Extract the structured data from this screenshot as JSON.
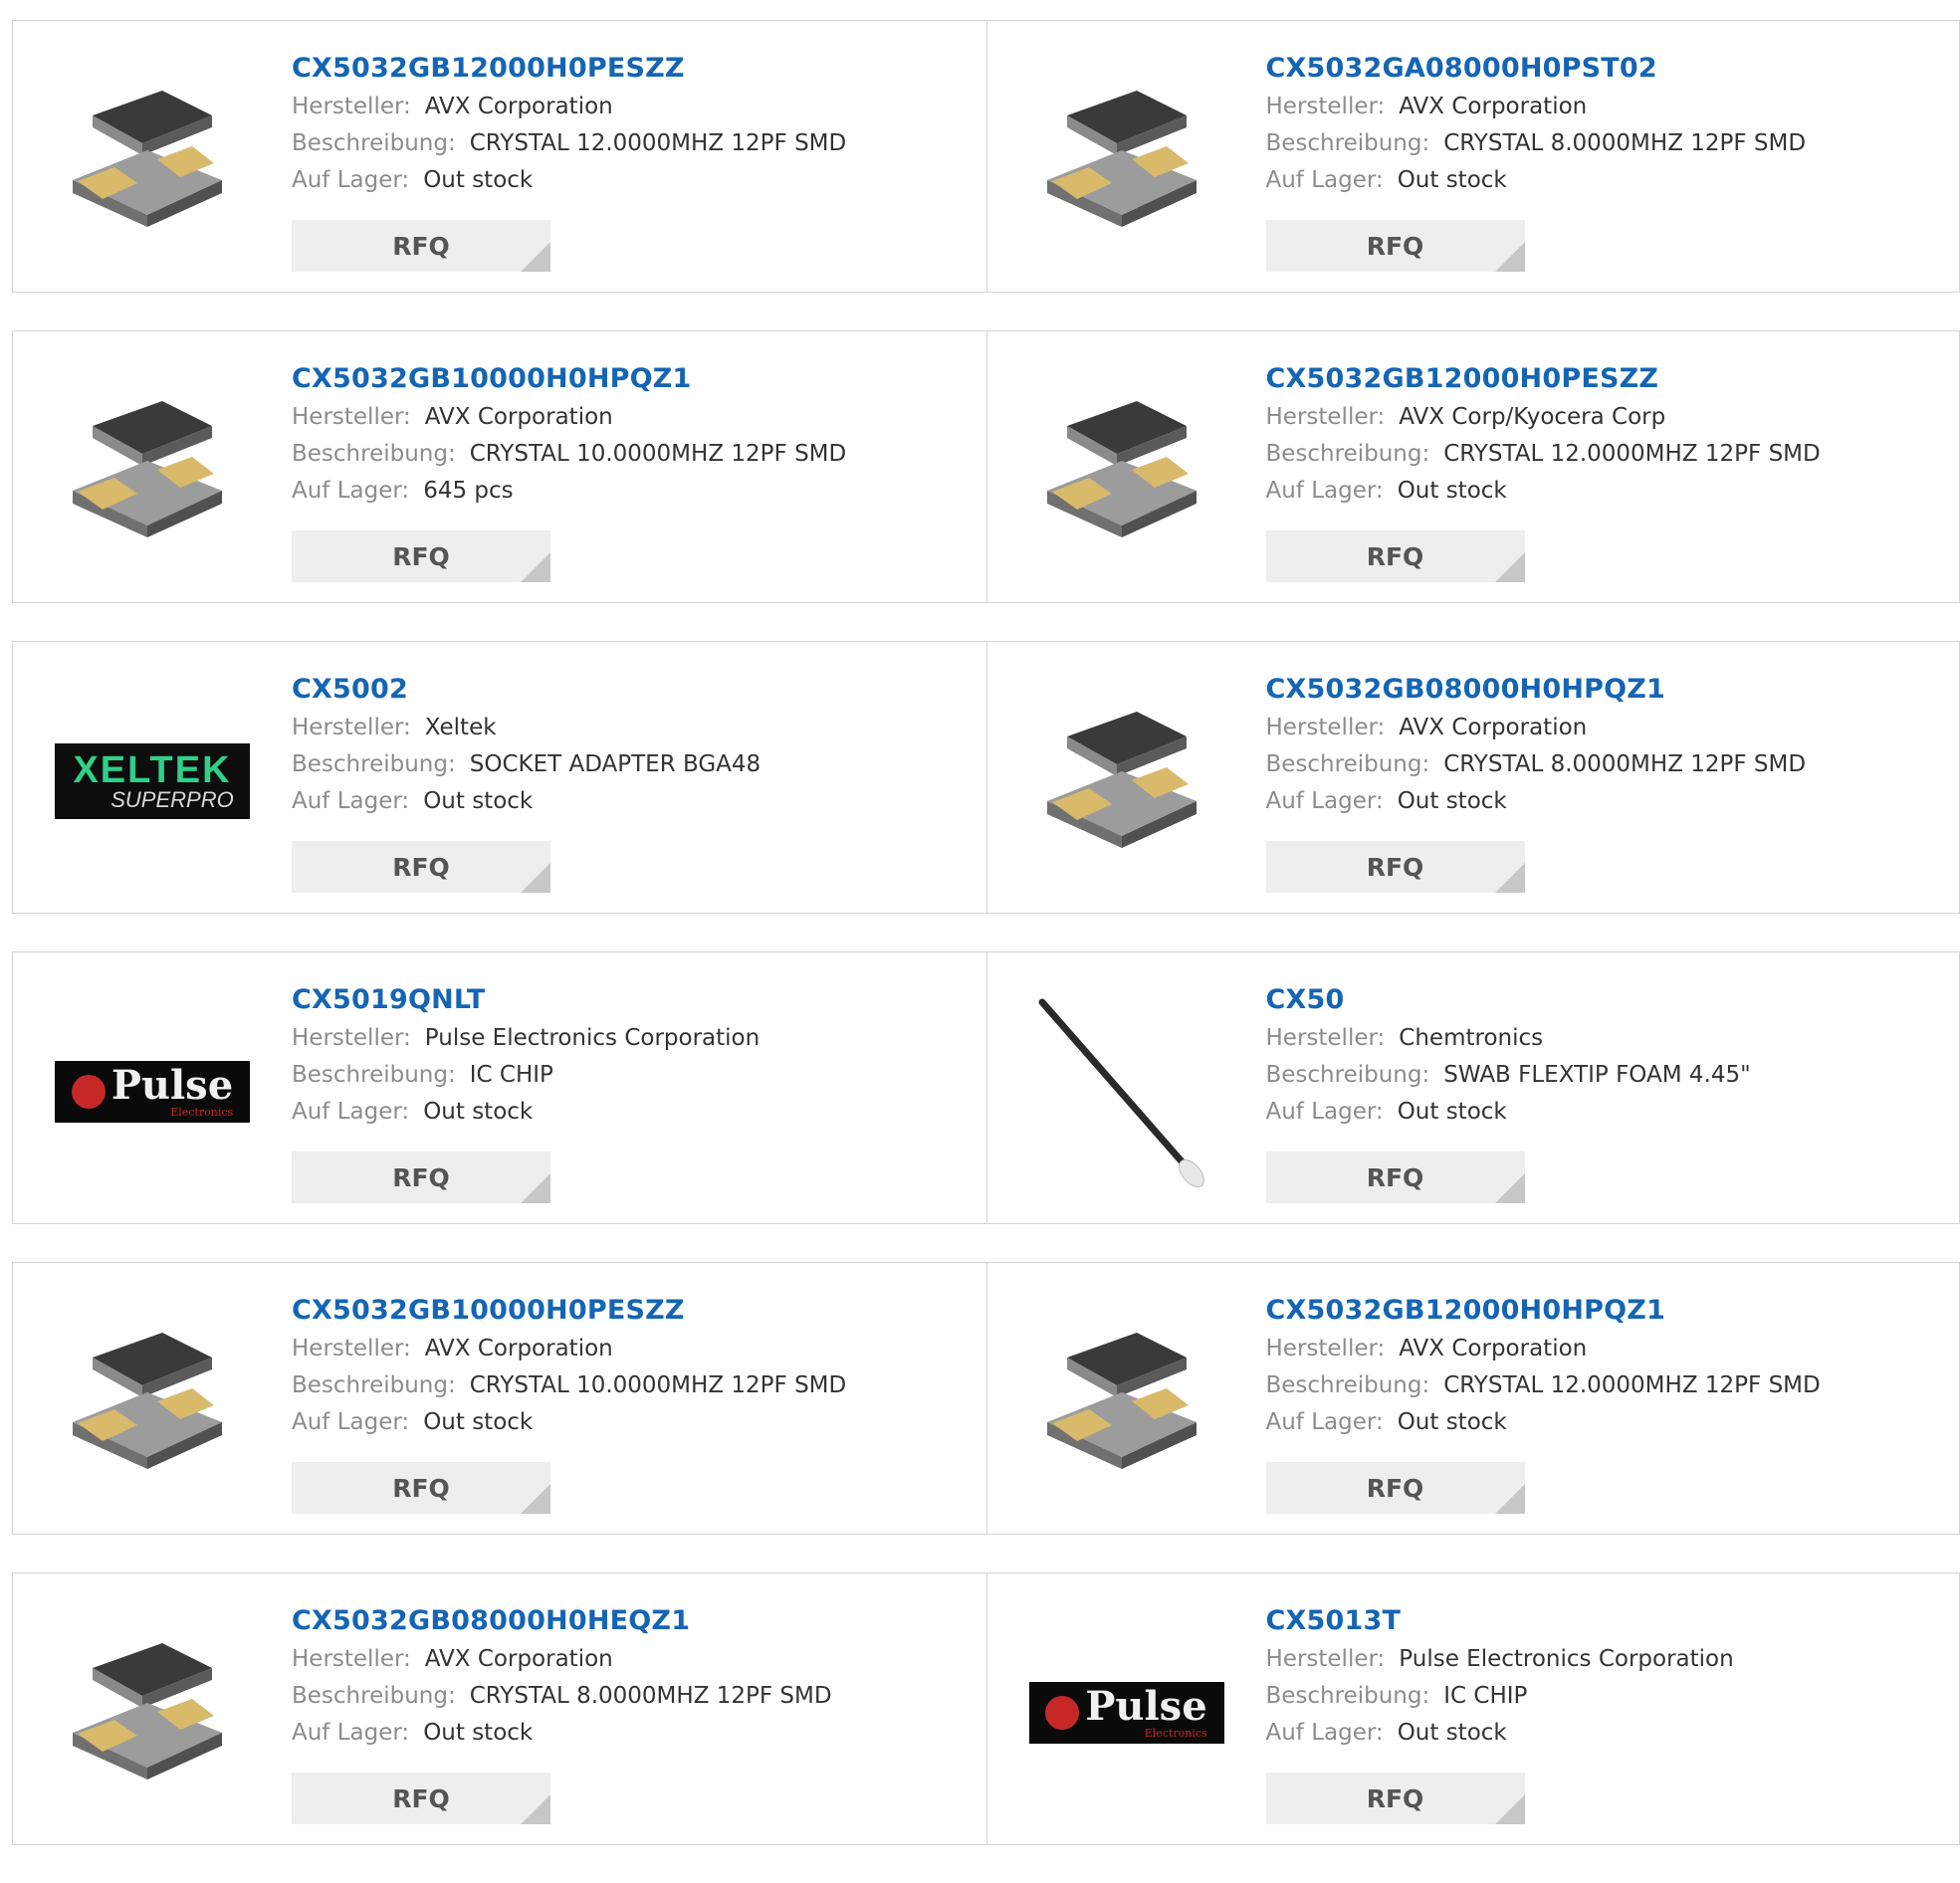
{
  "labels": {
    "manufacturer": "Hersteller:",
    "description": "Beschreibung:",
    "stock": "Auf Lager:",
    "rfq": "RFQ"
  },
  "products": [
    {
      "part": "CX5032GB12000H0PESZZ",
      "manufacturer": "AVX Corporation",
      "description": "CRYSTAL 12.0000MHZ 12PF SMD",
      "stock": "Out stock",
      "image": "crystal"
    },
    {
      "part": "CX5032GA08000H0PST02",
      "manufacturer": "AVX Corporation",
      "description": "CRYSTAL 8.0000MHZ 12PF SMD",
      "stock": "Out stock",
      "image": "crystal"
    },
    {
      "part": "CX5032GB10000H0HPQZ1",
      "manufacturer": "AVX Corporation",
      "description": "CRYSTAL 10.0000MHZ 12PF SMD",
      "stock": "645 pcs",
      "image": "crystal"
    },
    {
      "part": "CX5032GB12000H0PESZZ",
      "manufacturer": "AVX Corp/Kyocera Corp",
      "description": "CRYSTAL 12.0000MHZ 12PF SMD",
      "stock": "Out stock",
      "image": "crystal"
    },
    {
      "part": "CX5002",
      "manufacturer": "Xeltek",
      "description": "SOCKET ADAPTER BGA48",
      "stock": "Out stock",
      "image": "xeltek",
      "logo_text": [
        "XELTEK",
        "SUPERPRO"
      ]
    },
    {
      "part": "CX5032GB08000H0HPQZ1",
      "manufacturer": "AVX Corporation",
      "description": "CRYSTAL 8.0000MHZ 12PF SMD",
      "stock": "Out stock",
      "image": "crystal"
    },
    {
      "part": "CX5019QNLT",
      "manufacturer": "Pulse Electronics Corporation",
      "description": "IC CHIP",
      "stock": "Out stock",
      "image": "pulse",
      "logo_text": [
        "Pulse",
        "Electronics"
      ]
    },
    {
      "part": "CX50",
      "manufacturer": "Chemtronics",
      "description": "SWAB FLEXTIP FOAM 4.45\"",
      "stock": "Out stock",
      "image": "swab"
    },
    {
      "part": "CX5032GB10000H0PESZZ",
      "manufacturer": "AVX Corporation",
      "description": "CRYSTAL 10.0000MHZ 12PF SMD",
      "stock": "Out stock",
      "image": "crystal"
    },
    {
      "part": "CX5032GB12000H0HPQZ1",
      "manufacturer": "AVX Corporation",
      "description": "CRYSTAL 12.0000MHZ 12PF SMD",
      "stock": "Out stock",
      "image": "crystal"
    },
    {
      "part": "CX5032GB08000H0HEQZ1",
      "manufacturer": "AVX Corporation",
      "description": "CRYSTAL 8.0000MHZ 12PF SMD",
      "stock": "Out stock",
      "image": "crystal"
    },
    {
      "part": "CX5013T",
      "manufacturer": "Pulse Electronics Corporation",
      "description": "IC CHIP",
      "stock": "Out stock",
      "image": "pulse",
      "logo_text": [
        "Pulse",
        "Electronics"
      ]
    }
  ],
  "colors": {
    "link": "#1565b4",
    "label": "#8c8c8c",
    "border": "#d4d4d4",
    "button_bg": "#eeeeee"
  }
}
